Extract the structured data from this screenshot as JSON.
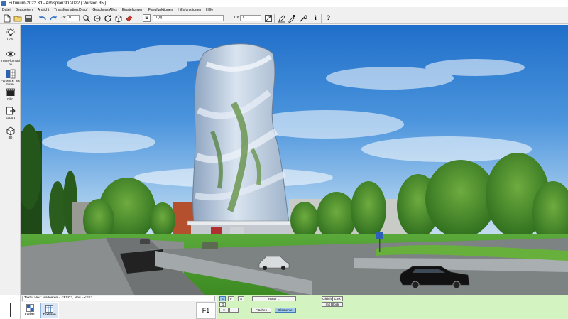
{
  "window": {
    "title": "Futurium-2022.3d - Arbisplan3D 2022 ( Version 35 )"
  },
  "menu": [
    "Datei",
    "Bearbeiten",
    "Ansicht",
    "Transformation:Drauf",
    "Geschoss:Alles",
    "Einstellungen",
    "Fangfunktionen",
    "Hilfsfunktionen",
    "Hilfe"
  ],
  "toolbar": {
    "zoom_label": "Zx:",
    "zoom_value": "0",
    "layer_value": "0 (0)",
    "count_label": "Cx:",
    "count_value": "1",
    "layer_box_icon": "E",
    "help_glyph": "?",
    "info_glyph": "i",
    "icons": [
      "new-file-icon",
      "open-folder-icon",
      "save-icon",
      "undo-icon",
      "redo-icon",
      "zoom-icon",
      "zoom-out-icon",
      "refresh-icon",
      "cube-icon",
      "eraser-icon",
      "layer-icon",
      "resize-icon",
      "pen-tool-icon",
      "color-picker-icon",
      "wrench-icon",
      "info-icon",
      "help-icon"
    ]
  },
  "left_panel": [
    {
      "label": "Licht",
      "icon": "light-bulb-icon"
    },
    {
      "label": "Trans-formation",
      "icon": "eye-icon"
    },
    {
      "label": "Farben & Texturen",
      "icon": "texture-icon"
    },
    {
      "label": "Film",
      "icon": "film-clapper-icon"
    },
    {
      "label": "Export",
      "icon": "export-icon"
    },
    {
      "label": "3D",
      "icon": "3d-box-icon"
    }
  ],
  "status": {
    "hint": "Textur Neu: Markieren = <ESC>, Neu = <F1>",
    "tabs": [
      {
        "label": "Farben",
        "icon": "palette-icon",
        "active": false
      },
      {
        "label": "Texturen",
        "icon": "texture-icon",
        "active": true
      }
    ],
    "f1_label": "F1",
    "buttons": {
      "e": "E",
      "f": "F",
      "s": "S",
      "texture": "Textur ...",
      "g": "G",
      "plus": "++",
      "minus": "--",
      "flaechen": "Flächen",
      "elemente": "Elemente",
      "gleich": "Gleich",
      "link": "Link",
      "mitblock": "mit Block"
    }
  },
  "colors": {
    "status_green": "#d3f3c1",
    "selected_button": "#9ec9f1",
    "sky": "#3d86d6"
  }
}
